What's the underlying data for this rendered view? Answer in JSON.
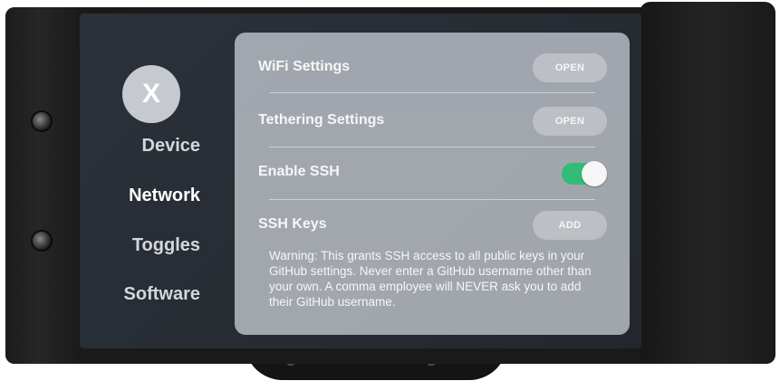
{
  "sidebar": {
    "close_label": "X",
    "items": [
      {
        "label": "Device",
        "active": false
      },
      {
        "label": "Network",
        "active": true
      },
      {
        "label": "Toggles",
        "active": false
      },
      {
        "label": "Software",
        "active": false
      }
    ]
  },
  "settings": {
    "wifi": {
      "label": "WiFi Settings",
      "button": "OPEN"
    },
    "tethering": {
      "label": "Tethering Settings",
      "button": "OPEN"
    },
    "ssh": {
      "label": "Enable SSH",
      "enabled": true
    },
    "ssh_keys": {
      "label": "SSH Keys",
      "button": "ADD"
    },
    "warning": "Warning: This grants SSH access to all public keys in your GitHub settings. Never enter a GitHub username other than your own. A comma employee will NEVER ask you to add their GitHub username."
  },
  "colors": {
    "panel": "#a7acb3",
    "screen": "#2b3139",
    "toggle_on": "#33c27a",
    "button": "#c3c7cc"
  }
}
